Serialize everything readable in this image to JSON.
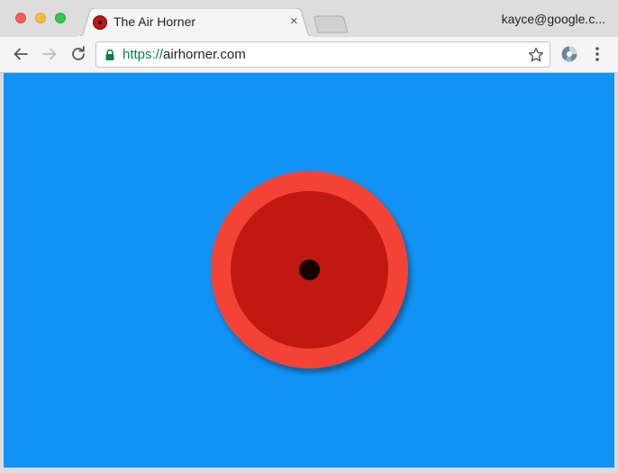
{
  "browser": {
    "tab": {
      "title": "The Air Horner",
      "favicon": "air-horn-favicon",
      "close_glyph": "×"
    },
    "profile_label": "kayce@google.c...",
    "address": {
      "scheme": "https://",
      "host": "airhorner.com",
      "secure": true
    },
    "icons": {
      "back": "back-arrow-icon",
      "forward": "forward-arrow-icon",
      "reload": "reload-icon",
      "lock": "lock-icon",
      "bookmark": "star-icon",
      "extension": "extension-icon",
      "menu": "kebab-menu-icon"
    }
  },
  "page": {
    "background_color": "#1193f5",
    "horn": {
      "outer_color": "#f44336",
      "inner_color": "#bf1912",
      "center_color": "#150000"
    }
  }
}
